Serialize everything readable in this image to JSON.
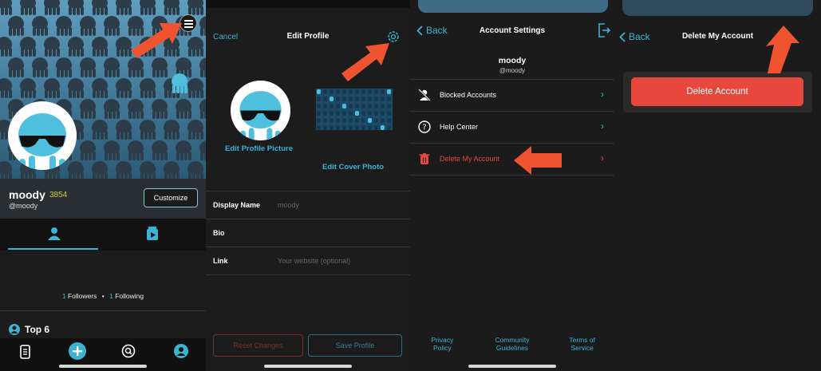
{
  "panel1": {
    "username": "moody",
    "score": "3854",
    "handle": "@moody",
    "customize_label": "Customize",
    "followers_count": "1",
    "followers_label": "Followers",
    "separator": "•",
    "following_count": "1",
    "following_label": "Following",
    "top_section_label": "Top 6"
  },
  "panel2": {
    "cancel_label": "Cancel",
    "title": "Edit Profile",
    "edit_picture_label": "Edit Profile Picture",
    "edit_cover_label": "Edit Cover Photo",
    "fields": [
      {
        "label": "Display Name",
        "value": "moody"
      },
      {
        "label": "Bio",
        "value": ""
      },
      {
        "label": "Link",
        "value": "Your website (optional)"
      }
    ],
    "reset_label": "Reset Changes",
    "save_label": "Save Profile"
  },
  "panel3": {
    "back_label": "Back",
    "title": "Account Settings",
    "username": "moody",
    "handle": "@moody",
    "rows": [
      {
        "label": "Blocked Accounts"
      },
      {
        "label": "Help Center"
      },
      {
        "label": "Delete My Account"
      }
    ],
    "footer": {
      "privacy": "Privacy Policy",
      "community": "Community Guidelines",
      "terms": "Terms of Service"
    }
  },
  "panel4": {
    "back_label": "Back",
    "title": "Delete My Account",
    "delete_button_label": "Delete Account"
  },
  "colors": {
    "accent": "#3db3d4",
    "danger": "#e8473e",
    "annotation_arrow": "#f0532f",
    "score": "#d7c94a"
  },
  "icons": [
    "menu-icon",
    "profile-tab-icon",
    "video-tab-icon",
    "top6-icon",
    "scroll-icon",
    "plus-icon",
    "search-icon",
    "account-icon",
    "gear-icon",
    "logout-icon",
    "blocked-user-icon",
    "help-icon",
    "trash-icon",
    "chevron-left-icon",
    "chevron-right-icon"
  ]
}
